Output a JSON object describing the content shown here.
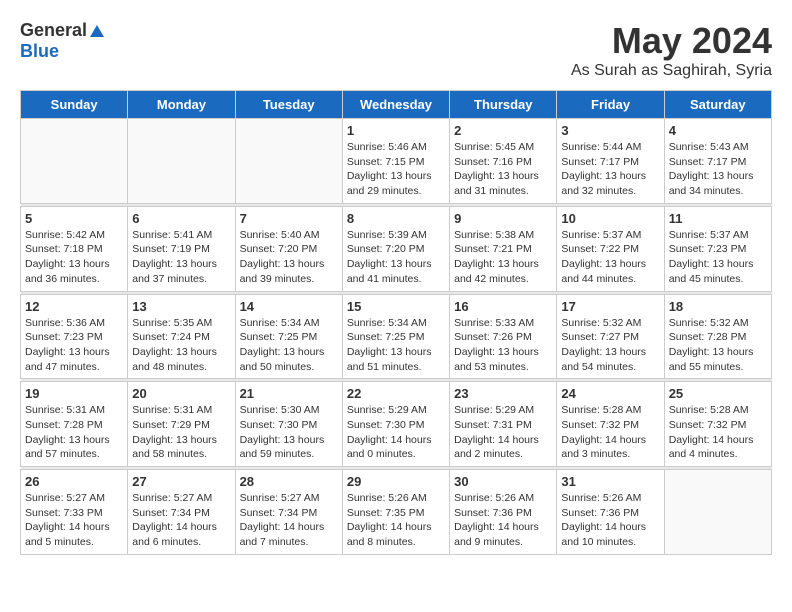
{
  "header": {
    "logo_general": "General",
    "logo_blue": "Blue",
    "month_year": "May 2024",
    "location": "As Surah as Saghirah, Syria"
  },
  "weekdays": [
    "Sunday",
    "Monday",
    "Tuesday",
    "Wednesday",
    "Thursday",
    "Friday",
    "Saturday"
  ],
  "weeks": [
    [
      {
        "day": "",
        "info": ""
      },
      {
        "day": "",
        "info": ""
      },
      {
        "day": "",
        "info": ""
      },
      {
        "day": "1",
        "info": "Sunrise: 5:46 AM\nSunset: 7:15 PM\nDaylight: 13 hours\nand 29 minutes."
      },
      {
        "day": "2",
        "info": "Sunrise: 5:45 AM\nSunset: 7:16 PM\nDaylight: 13 hours\nand 31 minutes."
      },
      {
        "day": "3",
        "info": "Sunrise: 5:44 AM\nSunset: 7:17 PM\nDaylight: 13 hours\nand 32 minutes."
      },
      {
        "day": "4",
        "info": "Sunrise: 5:43 AM\nSunset: 7:17 PM\nDaylight: 13 hours\nand 34 minutes."
      }
    ],
    [
      {
        "day": "5",
        "info": "Sunrise: 5:42 AM\nSunset: 7:18 PM\nDaylight: 13 hours\nand 36 minutes."
      },
      {
        "day": "6",
        "info": "Sunrise: 5:41 AM\nSunset: 7:19 PM\nDaylight: 13 hours\nand 37 minutes."
      },
      {
        "day": "7",
        "info": "Sunrise: 5:40 AM\nSunset: 7:20 PM\nDaylight: 13 hours\nand 39 minutes."
      },
      {
        "day": "8",
        "info": "Sunrise: 5:39 AM\nSunset: 7:20 PM\nDaylight: 13 hours\nand 41 minutes."
      },
      {
        "day": "9",
        "info": "Sunrise: 5:38 AM\nSunset: 7:21 PM\nDaylight: 13 hours\nand 42 minutes."
      },
      {
        "day": "10",
        "info": "Sunrise: 5:37 AM\nSunset: 7:22 PM\nDaylight: 13 hours\nand 44 minutes."
      },
      {
        "day": "11",
        "info": "Sunrise: 5:37 AM\nSunset: 7:23 PM\nDaylight: 13 hours\nand 45 minutes."
      }
    ],
    [
      {
        "day": "12",
        "info": "Sunrise: 5:36 AM\nSunset: 7:23 PM\nDaylight: 13 hours\nand 47 minutes."
      },
      {
        "day": "13",
        "info": "Sunrise: 5:35 AM\nSunset: 7:24 PM\nDaylight: 13 hours\nand 48 minutes."
      },
      {
        "day": "14",
        "info": "Sunrise: 5:34 AM\nSunset: 7:25 PM\nDaylight: 13 hours\nand 50 minutes."
      },
      {
        "day": "15",
        "info": "Sunrise: 5:34 AM\nSunset: 7:25 PM\nDaylight: 13 hours\nand 51 minutes."
      },
      {
        "day": "16",
        "info": "Sunrise: 5:33 AM\nSunset: 7:26 PM\nDaylight: 13 hours\nand 53 minutes."
      },
      {
        "day": "17",
        "info": "Sunrise: 5:32 AM\nSunset: 7:27 PM\nDaylight: 13 hours\nand 54 minutes."
      },
      {
        "day": "18",
        "info": "Sunrise: 5:32 AM\nSunset: 7:28 PM\nDaylight: 13 hours\nand 55 minutes."
      }
    ],
    [
      {
        "day": "19",
        "info": "Sunrise: 5:31 AM\nSunset: 7:28 PM\nDaylight: 13 hours\nand 57 minutes."
      },
      {
        "day": "20",
        "info": "Sunrise: 5:31 AM\nSunset: 7:29 PM\nDaylight: 13 hours\nand 58 minutes."
      },
      {
        "day": "21",
        "info": "Sunrise: 5:30 AM\nSunset: 7:30 PM\nDaylight: 13 hours\nand 59 minutes."
      },
      {
        "day": "22",
        "info": "Sunrise: 5:29 AM\nSunset: 7:30 PM\nDaylight: 14 hours\nand 0 minutes."
      },
      {
        "day": "23",
        "info": "Sunrise: 5:29 AM\nSunset: 7:31 PM\nDaylight: 14 hours\nand 2 minutes."
      },
      {
        "day": "24",
        "info": "Sunrise: 5:28 AM\nSunset: 7:32 PM\nDaylight: 14 hours\nand 3 minutes."
      },
      {
        "day": "25",
        "info": "Sunrise: 5:28 AM\nSunset: 7:32 PM\nDaylight: 14 hours\nand 4 minutes."
      }
    ],
    [
      {
        "day": "26",
        "info": "Sunrise: 5:27 AM\nSunset: 7:33 PM\nDaylight: 14 hours\nand 5 minutes."
      },
      {
        "day": "27",
        "info": "Sunrise: 5:27 AM\nSunset: 7:34 PM\nDaylight: 14 hours\nand 6 minutes."
      },
      {
        "day": "28",
        "info": "Sunrise: 5:27 AM\nSunset: 7:34 PM\nDaylight: 14 hours\nand 7 minutes."
      },
      {
        "day": "29",
        "info": "Sunrise: 5:26 AM\nSunset: 7:35 PM\nDaylight: 14 hours\nand 8 minutes."
      },
      {
        "day": "30",
        "info": "Sunrise: 5:26 AM\nSunset: 7:36 PM\nDaylight: 14 hours\nand 9 minutes."
      },
      {
        "day": "31",
        "info": "Sunrise: 5:26 AM\nSunset: 7:36 PM\nDaylight: 14 hours\nand 10 minutes."
      },
      {
        "day": "",
        "info": ""
      }
    ]
  ]
}
